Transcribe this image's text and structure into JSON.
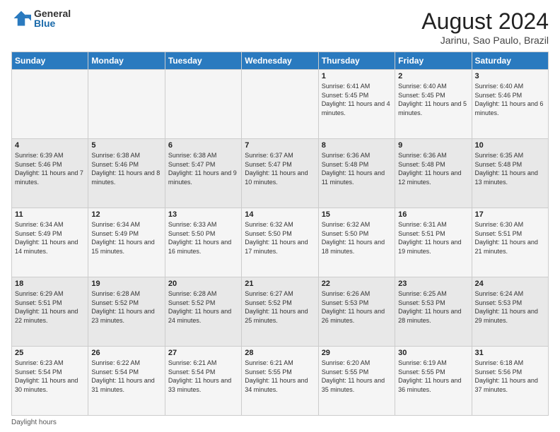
{
  "logo": {
    "general": "General",
    "blue": "Blue"
  },
  "title": "August 2024",
  "subtitle": "Jarinu, Sao Paulo, Brazil",
  "days_of_week": [
    "Sunday",
    "Monday",
    "Tuesday",
    "Wednesday",
    "Thursday",
    "Friday",
    "Saturday"
  ],
  "footer": "Daylight hours",
  "weeks": [
    [
      {
        "num": "",
        "info": ""
      },
      {
        "num": "",
        "info": ""
      },
      {
        "num": "",
        "info": ""
      },
      {
        "num": "",
        "info": ""
      },
      {
        "num": "1",
        "info": "Sunrise: 6:41 AM\nSunset: 5:45 PM\nDaylight: 11 hours and 4 minutes."
      },
      {
        "num": "2",
        "info": "Sunrise: 6:40 AM\nSunset: 5:45 PM\nDaylight: 11 hours and 5 minutes."
      },
      {
        "num": "3",
        "info": "Sunrise: 6:40 AM\nSunset: 5:46 PM\nDaylight: 11 hours and 6 minutes."
      }
    ],
    [
      {
        "num": "4",
        "info": "Sunrise: 6:39 AM\nSunset: 5:46 PM\nDaylight: 11 hours and 7 minutes."
      },
      {
        "num": "5",
        "info": "Sunrise: 6:38 AM\nSunset: 5:46 PM\nDaylight: 11 hours and 8 minutes."
      },
      {
        "num": "6",
        "info": "Sunrise: 6:38 AM\nSunset: 5:47 PM\nDaylight: 11 hours and 9 minutes."
      },
      {
        "num": "7",
        "info": "Sunrise: 6:37 AM\nSunset: 5:47 PM\nDaylight: 11 hours and 10 minutes."
      },
      {
        "num": "8",
        "info": "Sunrise: 6:36 AM\nSunset: 5:48 PM\nDaylight: 11 hours and 11 minutes."
      },
      {
        "num": "9",
        "info": "Sunrise: 6:36 AM\nSunset: 5:48 PM\nDaylight: 11 hours and 12 minutes."
      },
      {
        "num": "10",
        "info": "Sunrise: 6:35 AM\nSunset: 5:48 PM\nDaylight: 11 hours and 13 minutes."
      }
    ],
    [
      {
        "num": "11",
        "info": "Sunrise: 6:34 AM\nSunset: 5:49 PM\nDaylight: 11 hours and 14 minutes."
      },
      {
        "num": "12",
        "info": "Sunrise: 6:34 AM\nSunset: 5:49 PM\nDaylight: 11 hours and 15 minutes."
      },
      {
        "num": "13",
        "info": "Sunrise: 6:33 AM\nSunset: 5:50 PM\nDaylight: 11 hours and 16 minutes."
      },
      {
        "num": "14",
        "info": "Sunrise: 6:32 AM\nSunset: 5:50 PM\nDaylight: 11 hours and 17 minutes."
      },
      {
        "num": "15",
        "info": "Sunrise: 6:32 AM\nSunset: 5:50 PM\nDaylight: 11 hours and 18 minutes."
      },
      {
        "num": "16",
        "info": "Sunrise: 6:31 AM\nSunset: 5:51 PM\nDaylight: 11 hours and 19 minutes."
      },
      {
        "num": "17",
        "info": "Sunrise: 6:30 AM\nSunset: 5:51 PM\nDaylight: 11 hours and 21 minutes."
      }
    ],
    [
      {
        "num": "18",
        "info": "Sunrise: 6:29 AM\nSunset: 5:51 PM\nDaylight: 11 hours and 22 minutes."
      },
      {
        "num": "19",
        "info": "Sunrise: 6:28 AM\nSunset: 5:52 PM\nDaylight: 11 hours and 23 minutes."
      },
      {
        "num": "20",
        "info": "Sunrise: 6:28 AM\nSunset: 5:52 PM\nDaylight: 11 hours and 24 minutes."
      },
      {
        "num": "21",
        "info": "Sunrise: 6:27 AM\nSunset: 5:52 PM\nDaylight: 11 hours and 25 minutes."
      },
      {
        "num": "22",
        "info": "Sunrise: 6:26 AM\nSunset: 5:53 PM\nDaylight: 11 hours and 26 minutes."
      },
      {
        "num": "23",
        "info": "Sunrise: 6:25 AM\nSunset: 5:53 PM\nDaylight: 11 hours and 28 minutes."
      },
      {
        "num": "24",
        "info": "Sunrise: 6:24 AM\nSunset: 5:53 PM\nDaylight: 11 hours and 29 minutes."
      }
    ],
    [
      {
        "num": "25",
        "info": "Sunrise: 6:23 AM\nSunset: 5:54 PM\nDaylight: 11 hours and 30 minutes."
      },
      {
        "num": "26",
        "info": "Sunrise: 6:22 AM\nSunset: 5:54 PM\nDaylight: 11 hours and 31 minutes."
      },
      {
        "num": "27",
        "info": "Sunrise: 6:21 AM\nSunset: 5:54 PM\nDaylight: 11 hours and 33 minutes."
      },
      {
        "num": "28",
        "info": "Sunrise: 6:21 AM\nSunset: 5:55 PM\nDaylight: 11 hours and 34 minutes."
      },
      {
        "num": "29",
        "info": "Sunrise: 6:20 AM\nSunset: 5:55 PM\nDaylight: 11 hours and 35 minutes."
      },
      {
        "num": "30",
        "info": "Sunrise: 6:19 AM\nSunset: 5:55 PM\nDaylight: 11 hours and 36 minutes."
      },
      {
        "num": "31",
        "info": "Sunrise: 6:18 AM\nSunset: 5:56 PM\nDaylight: 11 hours and 37 minutes."
      }
    ]
  ]
}
